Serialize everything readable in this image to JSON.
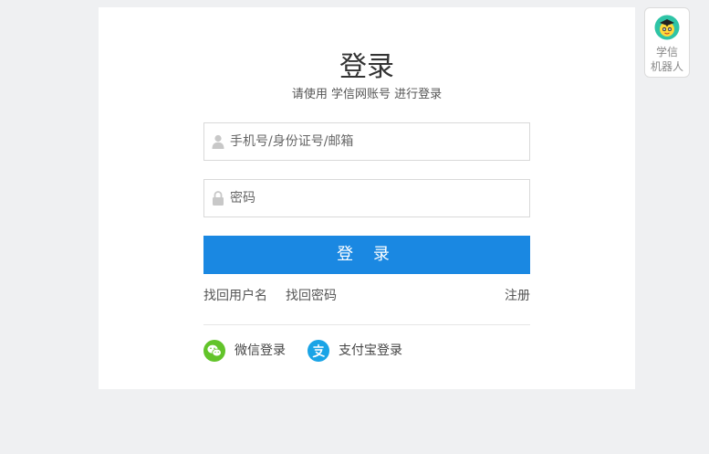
{
  "login": {
    "title": "登录",
    "subtitle": "请使用 学信网账号 进行登录",
    "username_placeholder": "手机号/身份证号/邮箱",
    "password_placeholder": "密码",
    "submit_label": "登 录"
  },
  "links": {
    "recover_username": "找回用户名",
    "recover_password": "找回密码",
    "register": "注册"
  },
  "social": {
    "wechat_label": "微信登录",
    "wechat_icon": "wechat-icon",
    "alipay_label": "支付宝登录",
    "alipay_icon": "alipay-icon"
  },
  "robot": {
    "line1": "学信",
    "line2": "机器人",
    "icon": "robot-avatar-icon"
  },
  "colors": {
    "primary": "#1a88e2",
    "background": "#eff0f2",
    "wechat": "#62c42a",
    "alipay": "#1aa4e6"
  }
}
